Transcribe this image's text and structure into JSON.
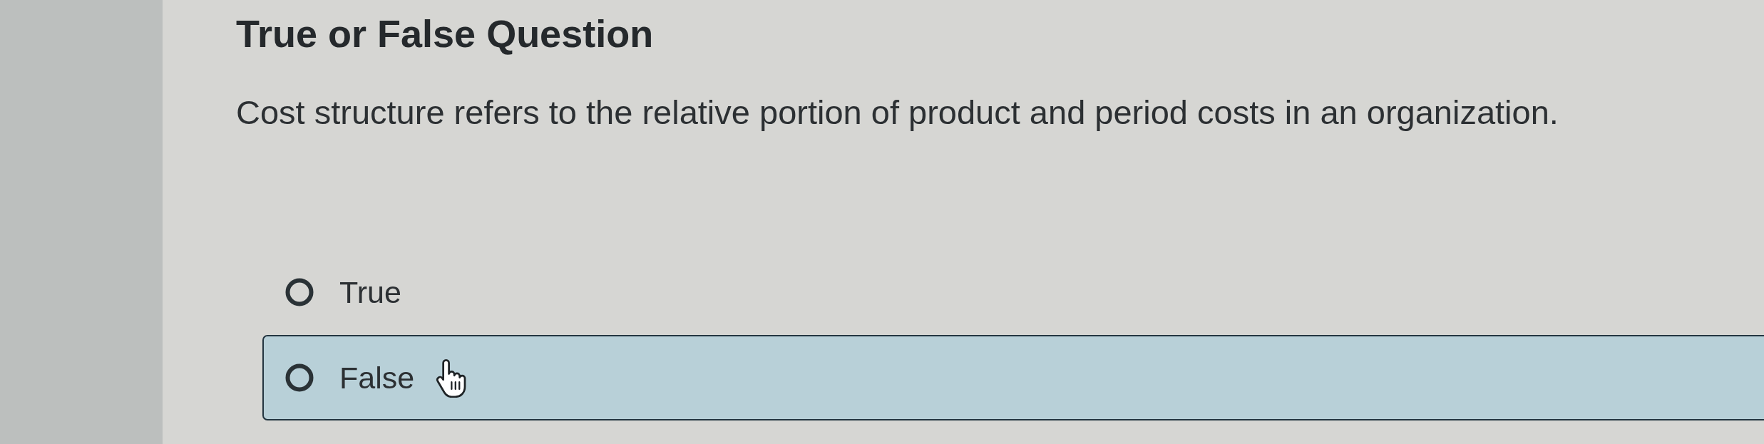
{
  "title": "True or False Question",
  "question": "Cost structure refers to the relative portion of product and period costs in an organization.",
  "options": [
    {
      "label": "True",
      "selected": false,
      "hovered": false
    },
    {
      "label": "False",
      "selected": false,
      "hovered": true
    }
  ]
}
